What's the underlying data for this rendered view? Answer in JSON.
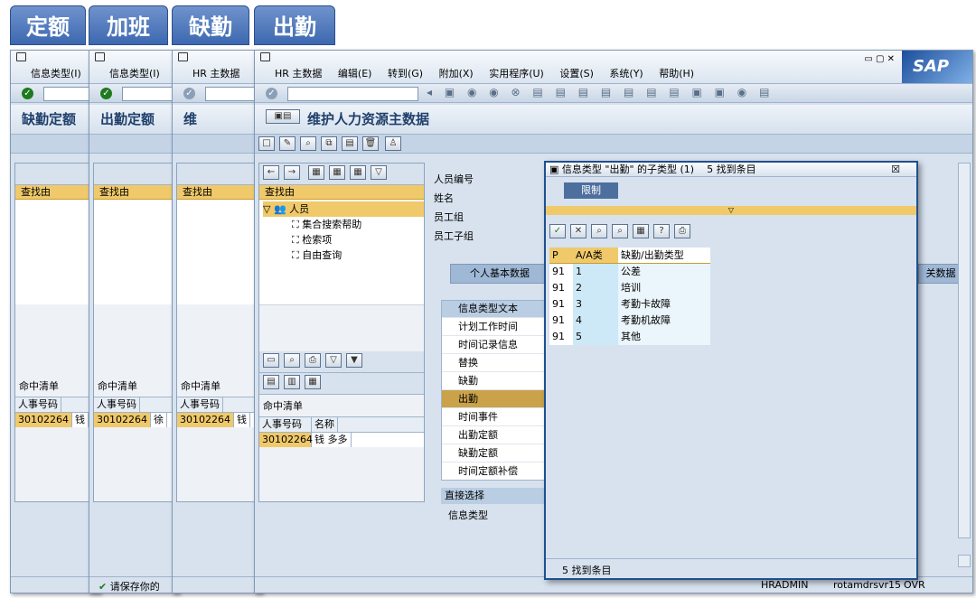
{
  "tabs": [
    "定额",
    "加班",
    "缺勤",
    "出勤"
  ],
  "window": {
    "menu": [
      "HR 主数据",
      "编辑(E)",
      "转到(G)",
      "附加(X)",
      "实用程序(U)",
      "设置(S)",
      "系统(Y)",
      "帮助(H)"
    ],
    "brand": "SAP",
    "title": "维护人力资源主数据",
    "left_panel": {
      "find_label": "查找由",
      "root": "人员",
      "items": [
        "集合搜索帮助",
        "检索项",
        "自由查询"
      ],
      "hits_label": "命中清单",
      "col_id": "人事号码",
      "col_name": "名称",
      "row_id": "30102264",
      "row_name": "钱 多多"
    },
    "fields": [
      "人员编号",
      "姓名",
      "员工组",
      "员工子组"
    ],
    "tab_personal": "个人基本数据",
    "tab_related": "关数据",
    "infotype_header": "信息类型文本",
    "infotypes": [
      "计划工作时间",
      "时间记录信息",
      "替换",
      "缺勤",
      "出勤",
      "时间事件",
      "出勤定额",
      "缺勤定额",
      "时间定额补偿"
    ],
    "direct_label": "直接选择",
    "direct_field": "信息类型",
    "status_user": "HRADMIN",
    "status_server": "rotamdrsvr15",
    "status_mode": "OVR"
  },
  "back_windows": [
    {
      "menu": "信息类型(I)",
      "title": "缺勤定额",
      "name": "钱"
    },
    {
      "menu": "信息类型(I)",
      "title": "出勤定额",
      "name": "徐",
      "status": "请保存你的"
    },
    {
      "menu": "HR 主数据",
      "title": "维",
      "name": "钱"
    }
  ],
  "popup": {
    "title": "信息类型 \"出勤\" 的子类型 (1)",
    "count": "5 找到条目",
    "restrict_tab": "限制",
    "columns": [
      "P",
      "A/A类",
      "缺勤/出勤类型"
    ],
    "rows": [
      {
        "p": "91",
        "code": "1",
        "text": "公差"
      },
      {
        "p": "91",
        "code": "2",
        "text": "培训"
      },
      {
        "p": "91",
        "code": "3",
        "text": "考勤卡故障"
      },
      {
        "p": "91",
        "code": "4",
        "text": "考勤机故障"
      },
      {
        "p": "91",
        "code": "5",
        "text": "其他"
      }
    ],
    "footer": "5 找到条目"
  }
}
